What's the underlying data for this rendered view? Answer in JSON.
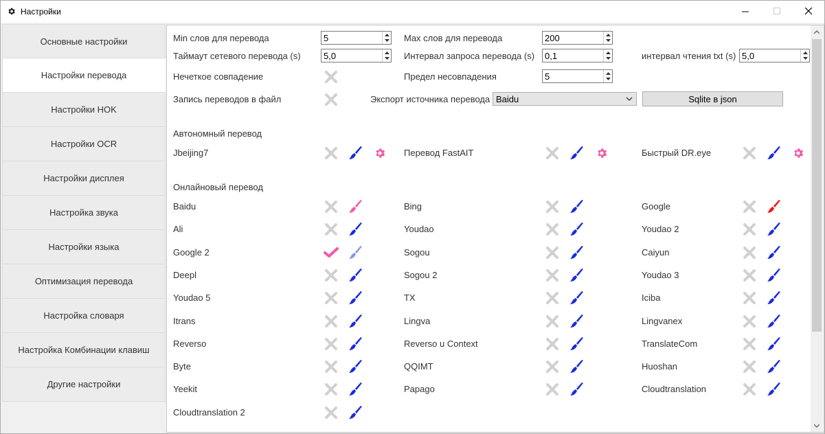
{
  "window": {
    "title": "Настройки"
  },
  "sidebar": {
    "items": [
      {
        "label": "Основные настройки",
        "active": false
      },
      {
        "label": "Настройки перевода",
        "active": true
      },
      {
        "label": "Настройки HOK",
        "active": false
      },
      {
        "label": "Настройки OCR",
        "active": false
      },
      {
        "label": "Настройки дисплея",
        "active": false
      },
      {
        "label": "Настройка звука",
        "active": false
      },
      {
        "label": "Настройки языка",
        "active": false
      },
      {
        "label": "Оптимизация перевода",
        "active": false
      },
      {
        "label": "Настройка словаря",
        "active": false
      },
      {
        "label": "Настройка Комбинации клавиш",
        "active": false
      },
      {
        "label": "Другие настройки",
        "active": false
      }
    ]
  },
  "settings": {
    "min_words": {
      "label": "Min слов для перевода",
      "value": "5"
    },
    "max_words": {
      "label": "Max слов для перевода",
      "value": "200"
    },
    "net_timeout": {
      "label": "Таймаут сетевого перевода (s)",
      "value": "5,0"
    },
    "request_interval": {
      "label": "Интервал запроса перевода (s)",
      "value": "0,1"
    },
    "txt_interval": {
      "label": "интервал чтения txt (s)",
      "value": "5,0"
    },
    "fuzzy_match": {
      "label": "Нечеткое совпадение"
    },
    "mismatch_limit": {
      "label": "Предел несовпадения",
      "value": "5"
    },
    "write_to_file": {
      "label": "Запись переводов в файл"
    },
    "export_source": {
      "label": "Экспорт источника перевода",
      "value": "Baidu"
    },
    "sqlite_button": {
      "label": "Sqlite в json"
    }
  },
  "offline": {
    "header": "Автономный перевод",
    "items": [
      {
        "name": "Jbeijing7",
        "enabled": false,
        "brush_color": "#1a2cdc"
      },
      {
        "name": "Перевод FastAIT",
        "enabled": false,
        "brush_color": "#1a2cdc"
      },
      {
        "name": "Быстрый DR.eye",
        "enabled": false,
        "brush_color": "#1a2cdc"
      }
    ]
  },
  "online": {
    "header": "Онлайновый перевод",
    "items": [
      {
        "name": "Baidu",
        "enabled": false,
        "brush_color": "#f25aa8"
      },
      {
        "name": "Bing",
        "enabled": false,
        "brush_color": "#1a2cdc"
      },
      {
        "name": "Google",
        "enabled": false,
        "brush_color": "#ee1515"
      },
      {
        "name": "Ali",
        "enabled": false,
        "brush_color": "#1a2cdc"
      },
      {
        "name": "Youdao",
        "enabled": false,
        "brush_color": "#1a2cdc"
      },
      {
        "name": "Youdao 2",
        "enabled": false,
        "brush_color": "#1a2cdc"
      },
      {
        "name": "Google 2",
        "enabled": true,
        "brush_color": "#8a97e8"
      },
      {
        "name": "Sogou",
        "enabled": false,
        "brush_color": "#1a2cdc"
      },
      {
        "name": "Caiyun",
        "enabled": false,
        "brush_color": "#1a2cdc"
      },
      {
        "name": "Deepl",
        "enabled": false,
        "brush_color": "#1a2cdc"
      },
      {
        "name": "Sogou 2",
        "enabled": false,
        "brush_color": "#1a2cdc"
      },
      {
        "name": "Youdao 3",
        "enabled": false,
        "brush_color": "#1a2cdc"
      },
      {
        "name": "Youdao 5",
        "enabled": false,
        "brush_color": "#1a2cdc"
      },
      {
        "name": "TX",
        "enabled": false,
        "brush_color": "#1a2cdc"
      },
      {
        "name": "Iciba",
        "enabled": false,
        "brush_color": "#1a2cdc"
      },
      {
        "name": "Itrans",
        "enabled": false,
        "brush_color": "#1a2cdc"
      },
      {
        "name": "Lingva",
        "enabled": false,
        "brush_color": "#1a2cdc"
      },
      {
        "name": "Lingvanex",
        "enabled": false,
        "brush_color": "#1a2cdc"
      },
      {
        "name": "Reverso",
        "enabled": false,
        "brush_color": "#1a2cdc"
      },
      {
        "name": "Reverso u Context",
        "enabled": false,
        "brush_color": "#1a2cdc"
      },
      {
        "name": "TranslateCom",
        "enabled": false,
        "brush_color": "#1a2cdc"
      },
      {
        "name": "Byte",
        "enabled": false,
        "brush_color": "#1a2cdc"
      },
      {
        "name": "QQIMT",
        "enabled": false,
        "brush_color": "#1a2cdc"
      },
      {
        "name": "Huoshan",
        "enabled": false,
        "brush_color": "#1a2cdc"
      },
      {
        "name": "Yeekit",
        "enabled": false,
        "brush_color": "#1a2cdc"
      },
      {
        "name": "Papago",
        "enabled": false,
        "brush_color": "#1a2cdc"
      },
      {
        "name": "Cloudtranslation",
        "enabled": false,
        "brush_color": "#1a2cdc"
      },
      {
        "name": "Cloudtranslation 2",
        "enabled": false,
        "brush_color": "#1a2cdc"
      }
    ]
  },
  "colors": {
    "toggle_off": "#d0d0d0",
    "toggle_on": "#f25aa8",
    "gear": "#f25aa8"
  }
}
